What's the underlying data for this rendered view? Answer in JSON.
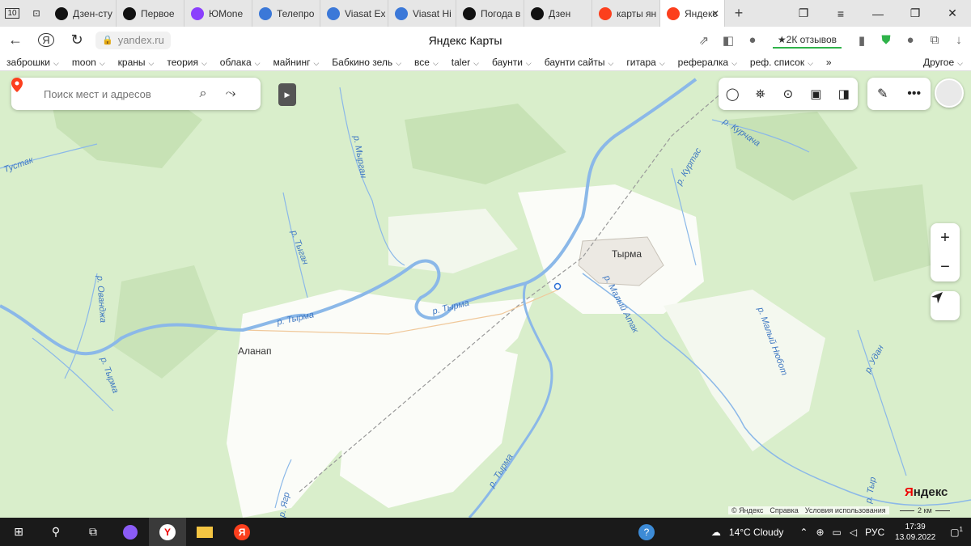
{
  "browser": {
    "tabs": [
      {
        "title": "Дзен-сту",
        "icon": "zen-icon",
        "color": "#111111"
      },
      {
        "title": "Первое",
        "icon": "zen-icon",
        "color": "#111111"
      },
      {
        "title": "ЮMone",
        "icon": "yoomoney-icon",
        "color": "#8b3ffd"
      },
      {
        "title": "Телепро",
        "icon": "tv-icon",
        "color": "#3b78d8"
      },
      {
        "title": "Viasat Ex",
        "icon": "tv-icon",
        "color": "#3b78d8"
      },
      {
        "title": "Viasat Hi",
        "icon": "tv-icon",
        "color": "#3b78d8"
      },
      {
        "title": "Погода в",
        "icon": "zen-icon",
        "color": "#111111"
      },
      {
        "title": "Дзен",
        "icon": "zen-icon",
        "color": "#111111"
      },
      {
        "title": "карты ян",
        "icon": "yandex-icon",
        "color": "#fc3f1d"
      },
      {
        "title": "Яндекс",
        "icon": "maps-pin-icon",
        "color": "#fc3f1d",
        "active": true
      }
    ],
    "tab_count": "10",
    "url": "yandex.ru",
    "page_title": "Яндекс Карты",
    "reviews": "★2К отзывов",
    "bookmarks": [
      "заброшки",
      "moon",
      "краны",
      "теория",
      "облака",
      "майнинг",
      "Бабкино зель",
      "все",
      "taler",
      "баунти",
      "баунти сайты",
      "гитара",
      "рефералка",
      "реф. список"
    ],
    "bookmarks_more": "»",
    "bookmarks_other": "Другое"
  },
  "map": {
    "search_placeholder": "Поиск мест и адресов",
    "towns": [
      "Тырма",
      "Аланап"
    ],
    "rivers": [
      "р. Тырма",
      "р. Тырма",
      "р. Тырма",
      "р. Тыган",
      "р. Мырган",
      "р. Курчача",
      "р. Куртас",
      "р. Малый Атак",
      "р. Малый Нюбот",
      "р. Ованджа",
      "р. Тырма",
      "р. Удан",
      "р. Тыр",
      "р. Ягр",
      "Тустак"
    ],
    "brand_red": "Я",
    "brand_rest": "ндекс",
    "footer": [
      "© Яндекс",
      "Справка",
      "Условия использования"
    ],
    "scale": "2 км",
    "colors": {
      "forest": "#d6ecc7",
      "forest_dark": "#c3e0b2",
      "river": "#8bb8e8",
      "road": "#9a9a9a"
    }
  },
  "taskbar": {
    "weather": "14°C  Cloudy",
    "lang": "РУС",
    "time": "17:39",
    "date": "13.09.2022",
    "notifications": "1"
  }
}
